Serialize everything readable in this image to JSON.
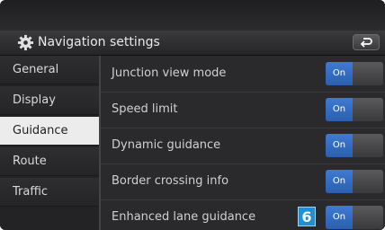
{
  "header": {
    "title": "Navigation settings",
    "settings_icon": "gear-icon",
    "back_icon": "back-arrow-icon"
  },
  "sidebar": {
    "items": [
      {
        "label": "General",
        "active": false
      },
      {
        "label": "Display",
        "active": false
      },
      {
        "label": "Guidance",
        "active": true
      },
      {
        "label": "Route",
        "active": false
      },
      {
        "label": "Traffic",
        "active": false
      }
    ]
  },
  "settings": {
    "rows": [
      {
        "label": "Junction view mode",
        "state": "On"
      },
      {
        "label": "Speed limit",
        "state": "On"
      },
      {
        "label": "Dynamic guidance",
        "state": "On"
      },
      {
        "label": "Border crossing info",
        "state": "On"
      },
      {
        "label": "Enhanced lane guidance",
        "state": "On",
        "callout": "6"
      }
    ]
  },
  "colors": {
    "toggle_on": "#3f7bd3",
    "callout": "#1f8fd6",
    "active_sidebar": "#ececec"
  }
}
